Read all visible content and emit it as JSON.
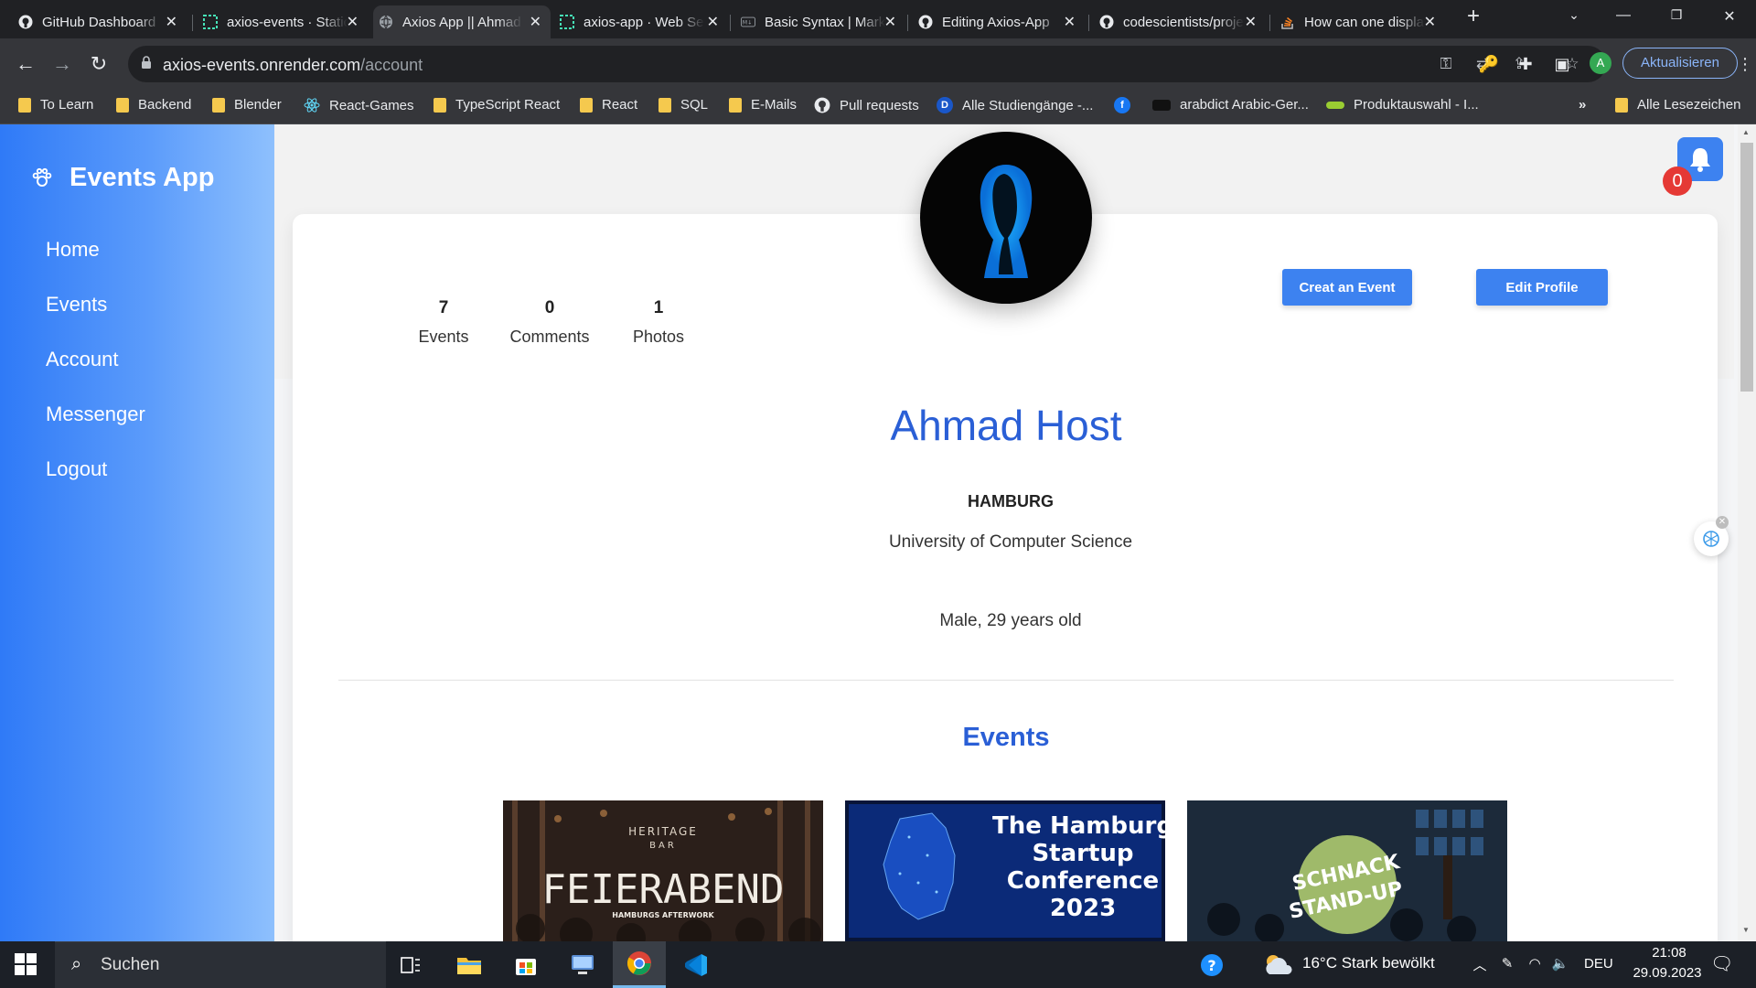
{
  "browser": {
    "tabs": [
      {
        "title": "GitHub Dashboard",
        "favicon": "github-icon"
      },
      {
        "title": "axios-events · Static Site",
        "favicon": "render-icon"
      },
      {
        "title": "Axios App || Ahmad",
        "favicon": "globe-icon",
        "active": true
      },
      {
        "title": "axios-app · Web Service",
        "favicon": "render-icon"
      },
      {
        "title": "Basic Syntax | Markdown",
        "favicon": "markdown-icon"
      },
      {
        "title": "Editing Axios-App",
        "favicon": "github-icon"
      },
      {
        "title": "codescientists/project",
        "favicon": "github-icon"
      },
      {
        "title": "How can one display",
        "favicon": "stackoverflow-icon"
      }
    ],
    "new_tab": "+",
    "url_host": "axios-events.onrender.com",
    "url_path": "/account",
    "update_label": "Aktualisieren",
    "profile_initial": "A",
    "bookmarks": [
      {
        "label": "To Learn",
        "type": "folder"
      },
      {
        "label": "Backend",
        "type": "folder"
      },
      {
        "label": "Blender",
        "type": "folder"
      },
      {
        "label": "React-Games",
        "type": "react-icon"
      },
      {
        "label": "TypeScript React",
        "type": "folder"
      },
      {
        "label": "React",
        "type": "folder"
      },
      {
        "label": "SQL",
        "type": "folder"
      },
      {
        "label": "E-Mails",
        "type": "folder"
      },
      {
        "label": "Pull requests",
        "type": "github-icon"
      },
      {
        "label": "Alle Studiengänge -...",
        "type": "d-icon"
      },
      {
        "label": "",
        "type": "facebook-icon"
      },
      {
        "label": "arabdict Arabic-Ger...",
        "type": "arabdict-icon"
      },
      {
        "label": "Produktauswahl - I...",
        "type": "product-icon"
      }
    ],
    "bookmarks_more": "»",
    "all_bookmarks": "Alle Lesezeichen"
  },
  "app": {
    "brand": "Events App",
    "nav": [
      "Home",
      "Events",
      "Account",
      "Messenger",
      "Logout"
    ],
    "stats": [
      {
        "value": "7",
        "label": "Events"
      },
      {
        "value": "0",
        "label": "Comments"
      },
      {
        "value": "1",
        "label": "Photos"
      }
    ],
    "create_event_label": "Creat an Event",
    "edit_profile_label": "Edit Profile",
    "notification_count": "0",
    "profile": {
      "name": "Ahmad Host",
      "city": "HAMBURG",
      "university": "University of Computer Science",
      "gender_age": "Male, 29 years old"
    },
    "events_heading": "Events",
    "event_cards": [
      {
        "line1": "HERITAGE",
        "line2": "BAR",
        "title": "FEIERABEND",
        "subtitle": "HAMBURGS AFTERWORK"
      },
      {
        "title_lines": [
          "The Hamburg",
          "Startup",
          "Conference",
          "2023"
        ]
      },
      {
        "title_lines": [
          "SCHNACK",
          "STAND-UP"
        ]
      }
    ]
  },
  "taskbar": {
    "search_placeholder": "Suchen",
    "weather": "16°C  Stark bewölkt",
    "language": "DEU",
    "time": "21:08",
    "date": "29.09.2023"
  },
  "colors": {
    "accent": "#3d82f0",
    "heading": "#2a5fd6",
    "sidebar_start": "#2f7af7",
    "sidebar_end": "#8ec0fd",
    "badge": "#e53935"
  }
}
